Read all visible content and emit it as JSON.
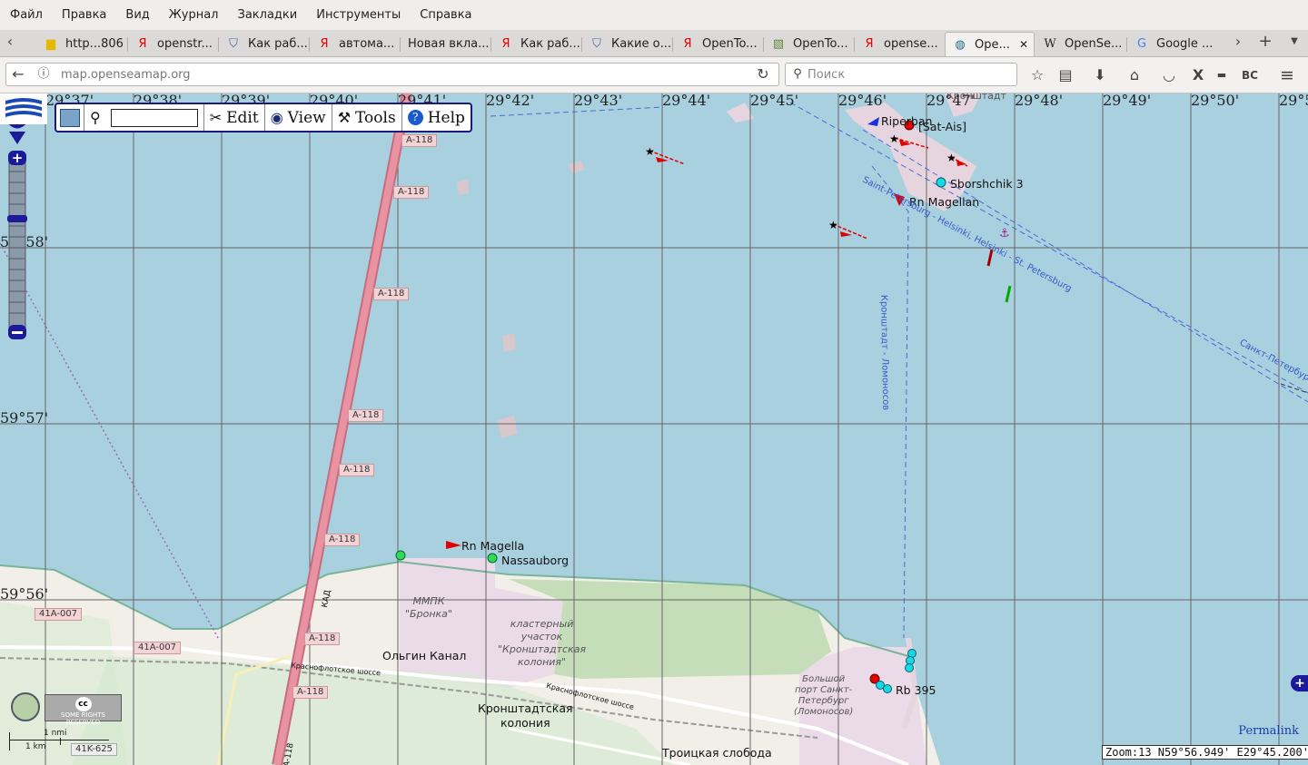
{
  "menubar": {
    "items": [
      "Файл",
      "Правка",
      "Вид",
      "Журнал",
      "Закладки",
      "Инструменты",
      "Справка"
    ]
  },
  "tabs": [
    {
      "label": "http...806",
      "icon": "folder-icon",
      "active": false
    },
    {
      "label": "openstr...",
      "icon": "yandex-icon",
      "active": false
    },
    {
      "label": "Как раб...",
      "icon": "shield-icon",
      "active": false
    },
    {
      "label": "автома...",
      "icon": "yandex-icon",
      "active": false
    },
    {
      "label": "Новая вкла...",
      "icon": "",
      "active": false
    },
    {
      "label": "Как раб...",
      "icon": "yandex-icon",
      "active": false
    },
    {
      "label": "Какие о...",
      "icon": "shield-icon",
      "active": false
    },
    {
      "label": "OpenTo...",
      "icon": "yandex-icon",
      "active": false
    },
    {
      "label": "OpenTo...",
      "icon": "map-icon",
      "active": false
    },
    {
      "label": "opense...",
      "icon": "yandex-icon",
      "active": false
    },
    {
      "label": "Ope...",
      "icon": "globe-icon",
      "active": true
    },
    {
      "label": "OpenSe...",
      "icon": "wikipedia-icon",
      "active": false
    },
    {
      "label": "Google ...",
      "icon": "translate-icon",
      "active": false
    }
  ],
  "navbar": {
    "url": "map.openseamap.org",
    "search_placeholder": "Поиск"
  },
  "map": {
    "longitudes": [
      "29°37'",
      "29°38'",
      "29°39'",
      "29°40'",
      "29°41'",
      "29°42'",
      "29°43'",
      "29°44'",
      "29°45'",
      "29°46'",
      "29°47'",
      "29°48'",
      "29°49'",
      "29°50'",
      "29°5"
    ],
    "latitudes": [
      "59°58'",
      "59°57'",
      "59°56'"
    ],
    "toolbar": {
      "edit": "Edit",
      "view": "View",
      "tools": "Tools",
      "help": "Help"
    },
    "road_shields": [
      "A-118",
      "A-118",
      "A-118",
      "A-118",
      "A-118",
      "A-118",
      "A-118",
      "A-118",
      "A-118",
      "41A-007",
      "41A-007",
      "41K-625"
    ],
    "vessels": [
      {
        "name": "Riperban",
        "color": "#1a2ee0"
      },
      {
        "name": "[Sat-Ais]",
        "color": "#e00000"
      },
      {
        "name": "Sborshchik 3",
        "color": "#18d8e8"
      },
      {
        "name": "Rn Magellan",
        "color": "#e00000"
      },
      {
        "name": "Rn Magella",
        "color": "#e00000"
      },
      {
        "name": "Nassauborg",
        "color": "#2edc5a"
      },
      {
        "name": "Rb 395",
        "color": "#18d8e8"
      }
    ],
    "place_labels": {
      "mmpk": "ММПК\n\"Бронка\"",
      "olgin": "Ольгин Канал",
      "cluster": "кластерный\nучасток\n\"Кронштадтская\nколония\"",
      "kronshtadt_colony": "Кронштадтская\nколония",
      "port": "Большой\nпорт Санкт-\nПетербург\n(Ломоносов)",
      "troitskaya": "Троицкая слобода",
      "road1": "Краснофлотское шоссе",
      "road2": "Краснофлотское шоссе",
      "kad": "КАД",
      "route1": "Saint-Petersburg - Helsinki, Helsinki - St. Petersburg",
      "route2": "Кронштадт - Ломоносов",
      "route3": "Санкт-Петербург",
      "island": "Кронштадт"
    },
    "permalink": "Permalink",
    "zoom_info": "Zoom:13 N59°56.949' E29°45.200'",
    "cc_badge": "SOME RIGHTS RESERVED",
    "scale": {
      "nmi": "1 nmi",
      "km": "1 km"
    },
    "colors": {
      "water": "#a9d0df",
      "land": "#f2efe9",
      "industrial": "#ebdbe8",
      "motorway": "#e892a2",
      "grid": "#666666"
    }
  }
}
